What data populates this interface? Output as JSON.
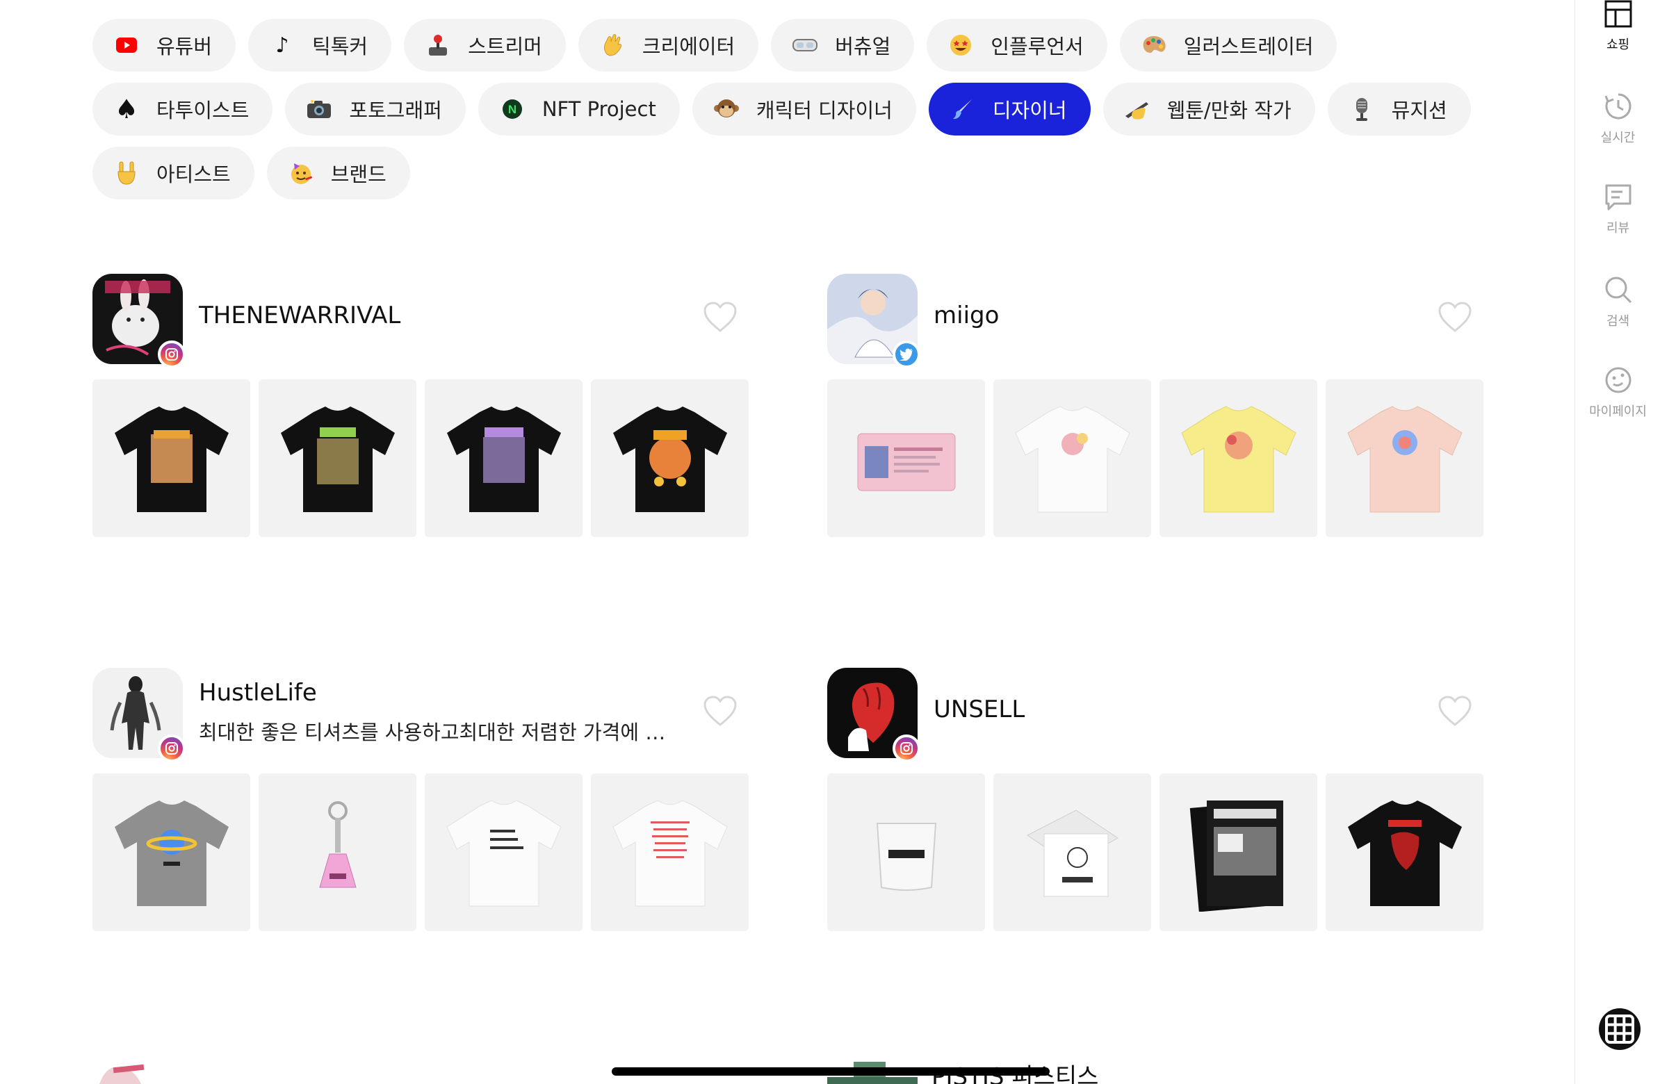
{
  "categories": [
    [
      {
        "label": "유튜버",
        "icon": "youtube-icon",
        "emoji": "▶"
      },
      {
        "label": "틱톡커",
        "icon": "tiktok-icon",
        "emoji": "♪"
      },
      {
        "label": "스트리머",
        "icon": "joystick-icon",
        "emoji": "🕹"
      },
      {
        "label": "크리에이터",
        "icon": "waving-hand-icon",
        "emoji": "👋"
      },
      {
        "label": "버츄얼",
        "icon": "vr-goggles-icon",
        "emoji": "🥽"
      },
      {
        "label": "인플루언서",
        "icon": "star-struck-icon",
        "emoji": "🤩"
      },
      {
        "label": "일러스트레이터",
        "icon": "palette-icon",
        "emoji": "🎨"
      }
    ],
    [
      {
        "label": "타투이스트",
        "icon": "spade-icon",
        "emoji": "♠"
      },
      {
        "label": "포토그래퍼",
        "icon": "camera-icon",
        "emoji": "📸"
      },
      {
        "label": "NFT Project",
        "icon": "nft-icon",
        "emoji": "N"
      },
      {
        "label": "캐릭터 디자이너",
        "icon": "monkey-icon",
        "emoji": "🐵"
      },
      {
        "label": "디자이너",
        "icon": "paintbrush-icon",
        "emoji": "🖌",
        "active": true
      },
      {
        "label": "웹툰/만화 작가",
        "icon": "writing-hand-icon",
        "emoji": "✍"
      },
      {
        "label": "뮤지션",
        "icon": "microphone-icon",
        "emoji": "🎙"
      }
    ],
    [
      {
        "label": "아티스트",
        "icon": "rock-hand-icon",
        "emoji": "🤘"
      },
      {
        "label": "브랜드",
        "icon": "party-face-icon",
        "emoji": "🥳"
      }
    ]
  ],
  "creators": [
    {
      "name": "THENEWARRIVAL",
      "description": "",
      "social": "instagram-icon",
      "products": [
        "black-tshirt",
        "black-tshirt",
        "black-tshirt",
        "black-tshirt"
      ]
    },
    {
      "name": "miigo",
      "description": "",
      "social": "twitter-icon",
      "products": [
        "id-card",
        "white-tshirt",
        "yellow-tshirt",
        "pink-tshirt"
      ]
    },
    {
      "name": "HustleLife",
      "description": "최대한 좋은 티셔츠를 사용하고최대한 저렴한 가격에 …",
      "social": "instagram-icon",
      "products": [
        "gray-ufo-tshirt",
        "keyring",
        "white-tshirt",
        "white-tshirt"
      ]
    },
    {
      "name": "UNSELL",
      "description": "",
      "social": "instagram-icon",
      "products": [
        "glass",
        "card",
        "poster",
        "black-tshirt"
      ]
    }
  ],
  "peek_creator": {
    "name": "PISTIS 피스티스"
  },
  "sidenav": [
    {
      "label": "쇼핑",
      "icon": "shopping-layout-icon",
      "active": true
    },
    {
      "label": "실시간",
      "icon": "clock-refresh-icon",
      "active": false
    },
    {
      "label": "리뷰",
      "icon": "review-icon",
      "active": false
    },
    {
      "label": "검색",
      "icon": "search-icon",
      "active": false
    },
    {
      "label": "마이페이지",
      "icon": "smile-face-icon",
      "active": false
    }
  ],
  "colors": {
    "accent": "#1a23d9",
    "chip_bg": "#f3f3f3",
    "tile_bg": "#f2f2f2"
  }
}
